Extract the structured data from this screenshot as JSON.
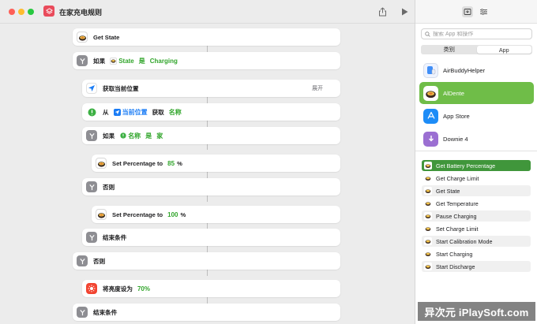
{
  "window": {
    "title": "在家充电规则"
  },
  "editor": {
    "actions": {
      "get_state": {
        "label": "Get State"
      },
      "if1": {
        "kw": "如果",
        "var": "State",
        "op": "是",
        "value": "Charging"
      },
      "get_location": {
        "label": "获取当前位置",
        "expand": "展开"
      },
      "get_details": {
        "from": "从",
        "var": "当前位置",
        "get": "获取",
        "param": "名称"
      },
      "if2": {
        "kw": "如果",
        "var": "名称",
        "op": "是",
        "value": "家"
      },
      "set85": {
        "label": "Set Percentage to",
        "value": "85",
        "unit": "%"
      },
      "else1": {
        "label": "否则"
      },
      "set100": {
        "label": "Set Percentage to",
        "value": "100",
        "unit": "%"
      },
      "endif1": {
        "label": "结束条件"
      },
      "else2": {
        "label": "否则"
      },
      "brightness": {
        "label": "将亮度设为",
        "value": "70%"
      },
      "endif2": {
        "label": "结束条件"
      }
    }
  },
  "sidebar": {
    "search_placeholder": "搜索 App 和操作",
    "segments": [
      "类别",
      "App"
    ],
    "apps": [
      {
        "name": "AirBuddyHelper",
        "icon": "airbuddy-icon"
      },
      {
        "name": "AlDente",
        "icon": "aldente-icon",
        "selected": true
      },
      {
        "name": "App Store",
        "icon": "appstore-icon"
      },
      {
        "name": "Downie 4",
        "icon": "downie-icon"
      }
    ],
    "app_actions": [
      "Get Battery Percentage",
      "Get Charge Limit",
      "Get State",
      "Get Temperature",
      "Pause Charging",
      "Set Charge Limit",
      "Start Calibration Mode",
      "Start Charging",
      "Start Discharge"
    ]
  },
  "watermark": "异次元 iPlaySoft.com",
  "colors": {
    "accent_green": "#31a52b",
    "selected_app": "#6fbd48",
    "selected_action": "#40963b"
  }
}
